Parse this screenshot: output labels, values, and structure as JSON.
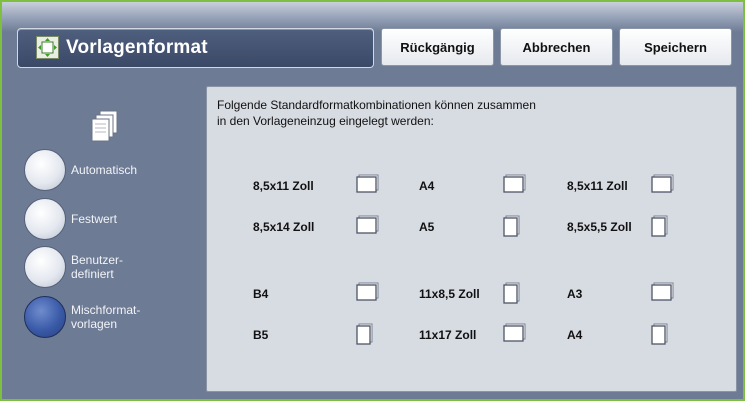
{
  "header": {
    "title": "Vorlagenformat",
    "buttons": {
      "undo": "Rückgängig",
      "cancel": "Abbrechen",
      "save": "Speichern"
    }
  },
  "sidebar": {
    "options": [
      {
        "id": "auto",
        "label_lines": [
          "Automatisch"
        ],
        "selected": false
      },
      {
        "id": "fixed",
        "label_lines": [
          "Festwert"
        ],
        "selected": false
      },
      {
        "id": "custom",
        "label_lines": [
          "Benutzer-",
          "definiert"
        ],
        "selected": false
      },
      {
        "id": "mixed",
        "label_lines": [
          "Mischformat-",
          "vorlagen"
        ],
        "selected": true
      }
    ]
  },
  "panel": {
    "intro_lines": [
      "Folgende Standardformatkombinationen können zusammen",
      "in den Vorlageneinzug eingelegt werden:"
    ],
    "groups": [
      [
        {
          "label": "8,5x11 Zoll",
          "orientation": "landscape"
        },
        {
          "label": "A4",
          "orientation": "landscape"
        },
        {
          "label": "8,5x11 Zoll",
          "orientation": "landscape"
        }
      ],
      [
        {
          "label": "8,5x14 Zoll",
          "orientation": "landscape"
        },
        {
          "label": "A5",
          "orientation": "portrait"
        },
        {
          "label": "8,5x5,5 Zoll",
          "orientation": "portrait"
        }
      ],
      [
        {
          "label": "B4",
          "orientation": "landscape"
        },
        {
          "label": "11x8,5 Zoll",
          "orientation": "portrait"
        },
        {
          "label": "A3",
          "orientation": "landscape"
        }
      ],
      [
        {
          "label": "B5",
          "orientation": "portrait"
        },
        {
          "label": "11x17 Zoll",
          "orientation": "landscape"
        },
        {
          "label": "A4",
          "orientation": "portrait"
        }
      ]
    ]
  },
  "colors": {
    "accent_border": "#7fbf3f",
    "selected_radio": "#3a5aa8"
  }
}
